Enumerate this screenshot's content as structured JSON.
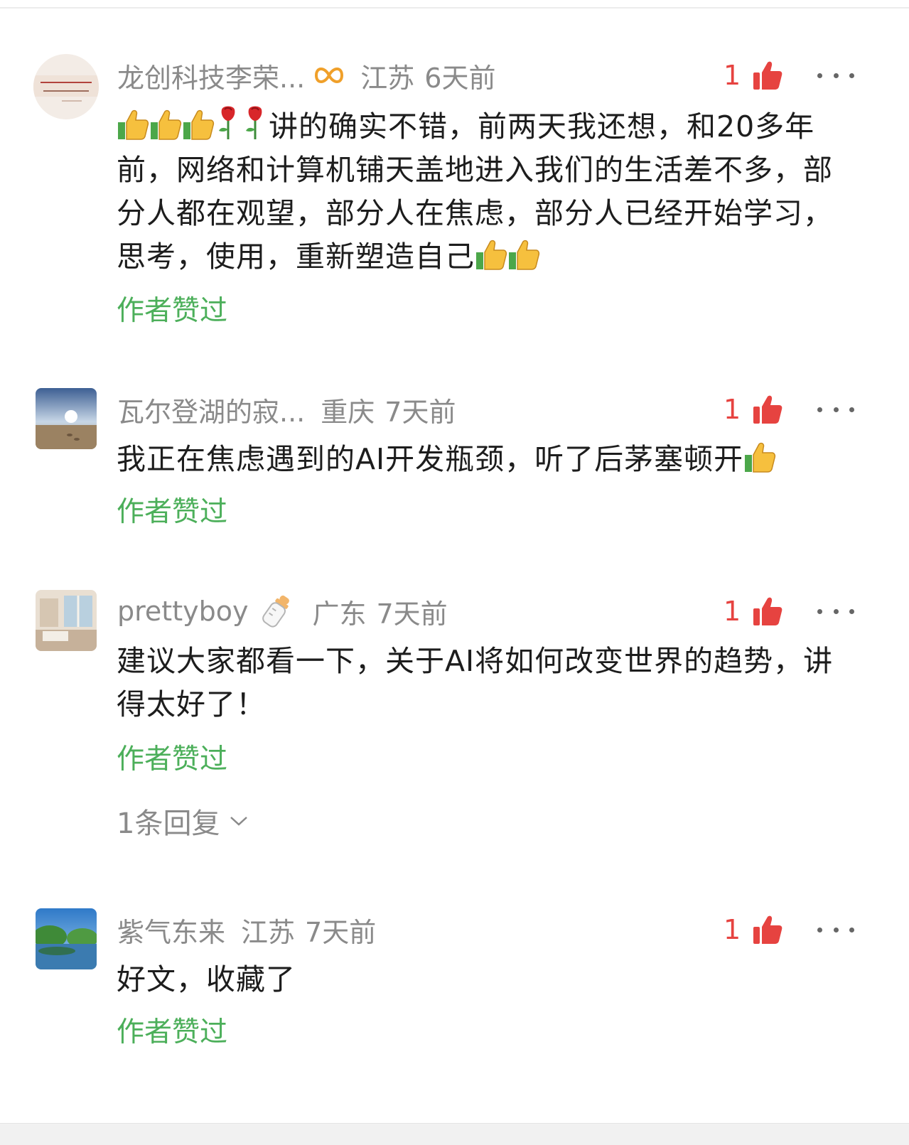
{
  "comments": [
    {
      "username": "龙创科技李荣...",
      "badge_icon": "infinity-icon",
      "location": "江苏",
      "time": "6天前",
      "likes": "1",
      "text_main": "讲的确实不错，前两天我还想，和20多年前，网络和计算机铺天盖地进入我们的生活差不多，部分人都在观望，部分人在焦虑，部分人已经开始学习，思考，使用，重新塑造自己",
      "author_liked": "作者赞过"
    },
    {
      "username": "瓦尔登湖的寂...",
      "location": "重庆",
      "time": "7天前",
      "likes": "1",
      "text_main": "我正在焦虑遇到的AI开发瓶颈，听了后茅塞顿开",
      "author_liked": "作者赞过"
    },
    {
      "username": "prettyboy",
      "badge_icon": "baby-bottle-icon",
      "location": "广东",
      "time": "7天前",
      "likes": "1",
      "text_main": "建议大家都看一下，关于AI将如何改变世界的趋势，讲得太好了！",
      "author_liked": "作者赞过",
      "replies_label": "1条回复"
    },
    {
      "username": "紫气东来",
      "location": "江苏",
      "time": "7天前",
      "likes": "1",
      "text_main": "好文，收藏了",
      "author_liked": "作者赞过"
    }
  ],
  "colors": {
    "like_red": "#e64340",
    "author_green": "#4caf5a",
    "meta_gray": "#8a8a8a",
    "text": "#1d1d1d"
  }
}
